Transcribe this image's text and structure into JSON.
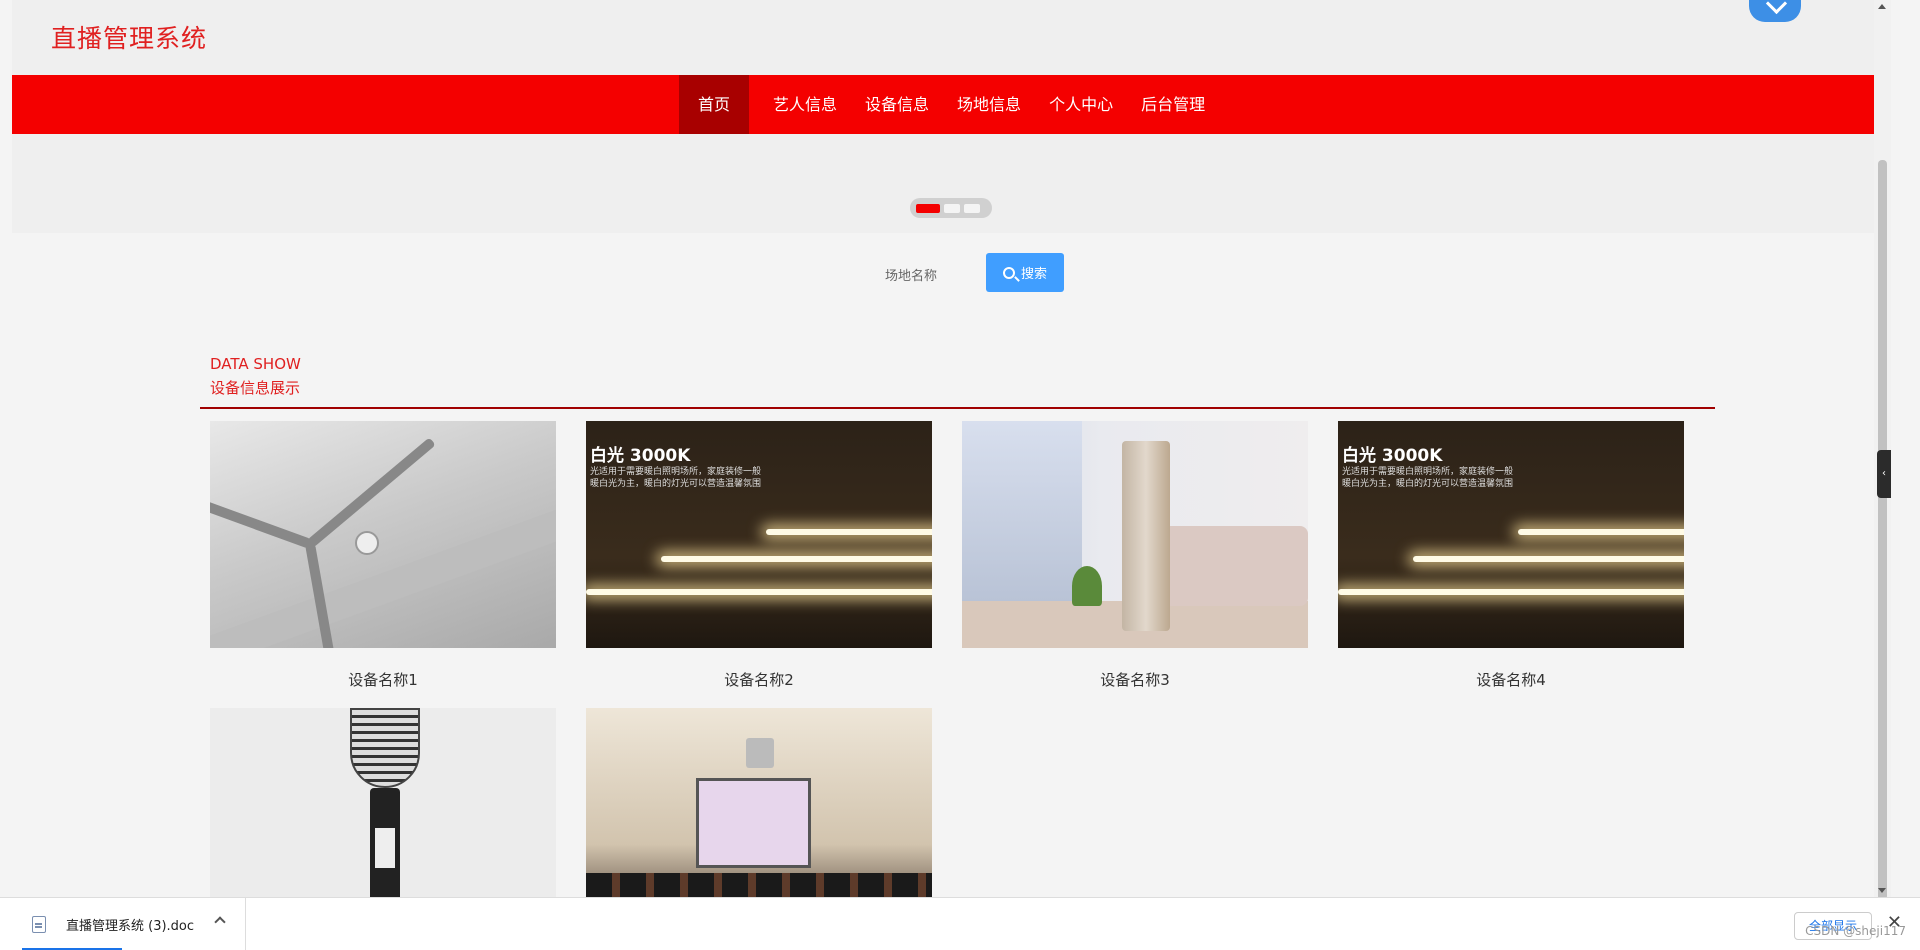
{
  "header": {
    "site_title": "直播管理系统"
  },
  "nav": {
    "items": [
      {
        "label": "首页",
        "active": true
      },
      {
        "label": "艺人信息"
      },
      {
        "label": "设备信息"
      },
      {
        "label": "场地信息"
      },
      {
        "label": "个人中心"
      },
      {
        "label": "后台管理"
      }
    ]
  },
  "banner": {
    "slide_count": 3,
    "active_slide": 1
  },
  "search": {
    "label": "场地名称",
    "button_label": "搜索"
  },
  "section": {
    "title_en": "DATA SHOW",
    "title_cn": "设备信息展示"
  },
  "devices": [
    {
      "name": "设备名称1",
      "image": "ceiling-fan"
    },
    {
      "name": "设备名称2",
      "image": "led-light-strip",
      "overlay_title": "白光 3000K",
      "overlay_text1": "光适用于需要暖白照明场所，家庭装修一般",
      "overlay_text2": "暖白光为主，暖白的灯光可以营造温馨氛围"
    },
    {
      "name": "设备名称3",
      "image": "air-conditioner"
    },
    {
      "name": "设备名称4",
      "image": "led-light-strip",
      "overlay_title": "白光 3000K",
      "overlay_text1": "光适用于需要暖白照明场所，家庭装修一般",
      "overlay_text2": "暖白光为主，暖白的灯光可以营造温馨氛围"
    },
    {
      "name": "",
      "image": "microphone"
    },
    {
      "name": "",
      "image": "meeting-room"
    }
  ],
  "download_bar": {
    "file_name": "直播管理系统 (3).doc",
    "show_all_label": "全部显示",
    "close_glyph": "✕"
  },
  "watermark": "CSDN @sheji117"
}
